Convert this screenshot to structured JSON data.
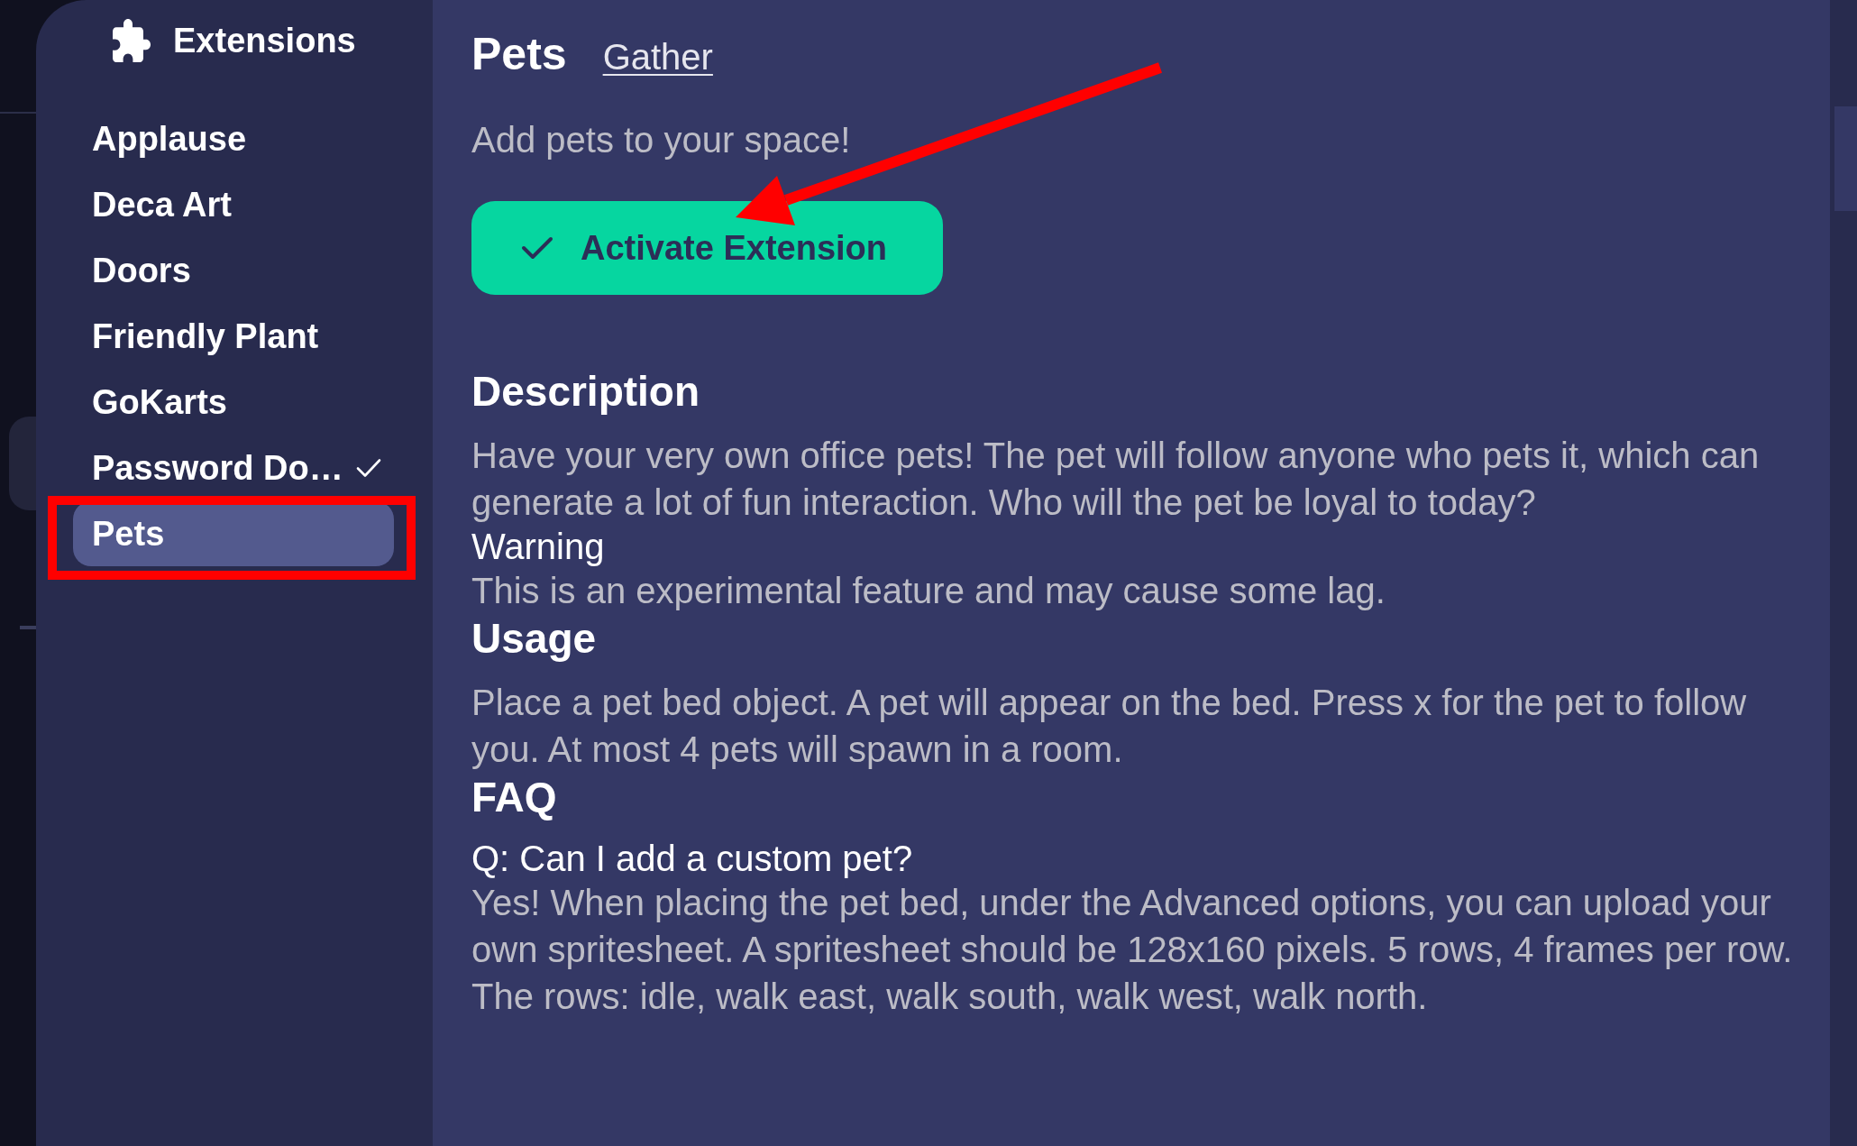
{
  "sidebar": {
    "title": "Extensions",
    "items": [
      {
        "label": "Applause",
        "selected": false,
        "checked": false
      },
      {
        "label": "Deca Art",
        "selected": false,
        "checked": false
      },
      {
        "label": "Doors",
        "selected": false,
        "checked": false
      },
      {
        "label": "Friendly Plant",
        "selected": false,
        "checked": false
      },
      {
        "label": "GoKarts",
        "selected": false,
        "checked": false
      },
      {
        "label": "Password Do…",
        "selected": false,
        "checked": true
      },
      {
        "label": "Pets",
        "selected": true,
        "checked": false
      }
    ]
  },
  "extension": {
    "name": "Pets",
    "author_link": "Gather",
    "tagline": "Add pets to your space!",
    "activate_button": {
      "label": "Activate Extension"
    },
    "sections": [
      {
        "kind": "heading",
        "text": "Description"
      },
      {
        "kind": "paragraph",
        "text": "Have your very own office pets! The pet will follow anyone who pets it, which can generate a lot of fun interaction. Who will the pet be loyal to today?"
      },
      {
        "kind": "subheading",
        "text": "Warning"
      },
      {
        "kind": "paragraph",
        "text": "This is an experimental feature and may cause some lag."
      },
      {
        "kind": "heading",
        "text": "Usage"
      },
      {
        "kind": "paragraph",
        "text": "Place a pet bed object. A pet will appear on the bed. Press x for the pet to follow you. At most 4 pets will spawn in a room."
      },
      {
        "kind": "heading",
        "text": "FAQ"
      },
      {
        "kind": "subheading",
        "text": "Q: Can I add a custom pet?"
      },
      {
        "kind": "paragraph",
        "text": "Yes! When placing the pet bed, under the Advanced options, you can upload your own spritesheet. A spritesheet should be 128x160 pixels. 5 rows, 4 frames per row. The rows: idle, walk east, walk south, walk west, walk north."
      }
    ]
  }
}
